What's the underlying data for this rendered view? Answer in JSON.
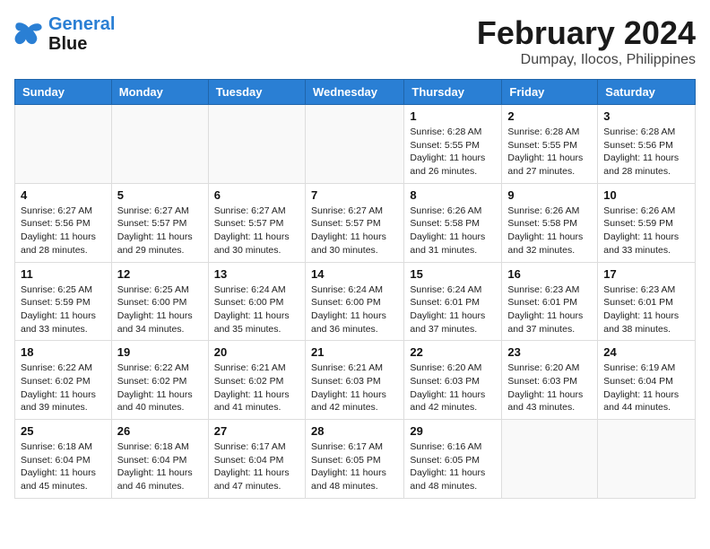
{
  "header": {
    "logo_line1": "General",
    "logo_line2": "Blue",
    "month_year": "February 2024",
    "location": "Dumpay, Ilocos, Philippines"
  },
  "weekdays": [
    "Sunday",
    "Monday",
    "Tuesday",
    "Wednesday",
    "Thursday",
    "Friday",
    "Saturday"
  ],
  "weeks": [
    [
      {
        "day": "",
        "text": ""
      },
      {
        "day": "",
        "text": ""
      },
      {
        "day": "",
        "text": ""
      },
      {
        "day": "",
        "text": ""
      },
      {
        "day": "1",
        "text": "Sunrise: 6:28 AM\nSunset: 5:55 PM\nDaylight: 11 hours and 26 minutes."
      },
      {
        "day": "2",
        "text": "Sunrise: 6:28 AM\nSunset: 5:55 PM\nDaylight: 11 hours and 27 minutes."
      },
      {
        "day": "3",
        "text": "Sunrise: 6:28 AM\nSunset: 5:56 PM\nDaylight: 11 hours and 28 minutes."
      }
    ],
    [
      {
        "day": "4",
        "text": "Sunrise: 6:27 AM\nSunset: 5:56 PM\nDaylight: 11 hours and 28 minutes."
      },
      {
        "day": "5",
        "text": "Sunrise: 6:27 AM\nSunset: 5:57 PM\nDaylight: 11 hours and 29 minutes."
      },
      {
        "day": "6",
        "text": "Sunrise: 6:27 AM\nSunset: 5:57 PM\nDaylight: 11 hours and 30 minutes."
      },
      {
        "day": "7",
        "text": "Sunrise: 6:27 AM\nSunset: 5:57 PM\nDaylight: 11 hours and 30 minutes."
      },
      {
        "day": "8",
        "text": "Sunrise: 6:26 AM\nSunset: 5:58 PM\nDaylight: 11 hours and 31 minutes."
      },
      {
        "day": "9",
        "text": "Sunrise: 6:26 AM\nSunset: 5:58 PM\nDaylight: 11 hours and 32 minutes."
      },
      {
        "day": "10",
        "text": "Sunrise: 6:26 AM\nSunset: 5:59 PM\nDaylight: 11 hours and 33 minutes."
      }
    ],
    [
      {
        "day": "11",
        "text": "Sunrise: 6:25 AM\nSunset: 5:59 PM\nDaylight: 11 hours and 33 minutes."
      },
      {
        "day": "12",
        "text": "Sunrise: 6:25 AM\nSunset: 6:00 PM\nDaylight: 11 hours and 34 minutes."
      },
      {
        "day": "13",
        "text": "Sunrise: 6:24 AM\nSunset: 6:00 PM\nDaylight: 11 hours and 35 minutes."
      },
      {
        "day": "14",
        "text": "Sunrise: 6:24 AM\nSunset: 6:00 PM\nDaylight: 11 hours and 36 minutes."
      },
      {
        "day": "15",
        "text": "Sunrise: 6:24 AM\nSunset: 6:01 PM\nDaylight: 11 hours and 37 minutes."
      },
      {
        "day": "16",
        "text": "Sunrise: 6:23 AM\nSunset: 6:01 PM\nDaylight: 11 hours and 37 minutes."
      },
      {
        "day": "17",
        "text": "Sunrise: 6:23 AM\nSunset: 6:01 PM\nDaylight: 11 hours and 38 minutes."
      }
    ],
    [
      {
        "day": "18",
        "text": "Sunrise: 6:22 AM\nSunset: 6:02 PM\nDaylight: 11 hours and 39 minutes."
      },
      {
        "day": "19",
        "text": "Sunrise: 6:22 AM\nSunset: 6:02 PM\nDaylight: 11 hours and 40 minutes."
      },
      {
        "day": "20",
        "text": "Sunrise: 6:21 AM\nSunset: 6:02 PM\nDaylight: 11 hours and 41 minutes."
      },
      {
        "day": "21",
        "text": "Sunrise: 6:21 AM\nSunset: 6:03 PM\nDaylight: 11 hours and 42 minutes."
      },
      {
        "day": "22",
        "text": "Sunrise: 6:20 AM\nSunset: 6:03 PM\nDaylight: 11 hours and 42 minutes."
      },
      {
        "day": "23",
        "text": "Sunrise: 6:20 AM\nSunset: 6:03 PM\nDaylight: 11 hours and 43 minutes."
      },
      {
        "day": "24",
        "text": "Sunrise: 6:19 AM\nSunset: 6:04 PM\nDaylight: 11 hours and 44 minutes."
      }
    ],
    [
      {
        "day": "25",
        "text": "Sunrise: 6:18 AM\nSunset: 6:04 PM\nDaylight: 11 hours and 45 minutes."
      },
      {
        "day": "26",
        "text": "Sunrise: 6:18 AM\nSunset: 6:04 PM\nDaylight: 11 hours and 46 minutes."
      },
      {
        "day": "27",
        "text": "Sunrise: 6:17 AM\nSunset: 6:04 PM\nDaylight: 11 hours and 47 minutes."
      },
      {
        "day": "28",
        "text": "Sunrise: 6:17 AM\nSunset: 6:05 PM\nDaylight: 11 hours and 48 minutes."
      },
      {
        "day": "29",
        "text": "Sunrise: 6:16 AM\nSunset: 6:05 PM\nDaylight: 11 hours and 48 minutes."
      },
      {
        "day": "",
        "text": ""
      },
      {
        "day": "",
        "text": ""
      }
    ]
  ]
}
